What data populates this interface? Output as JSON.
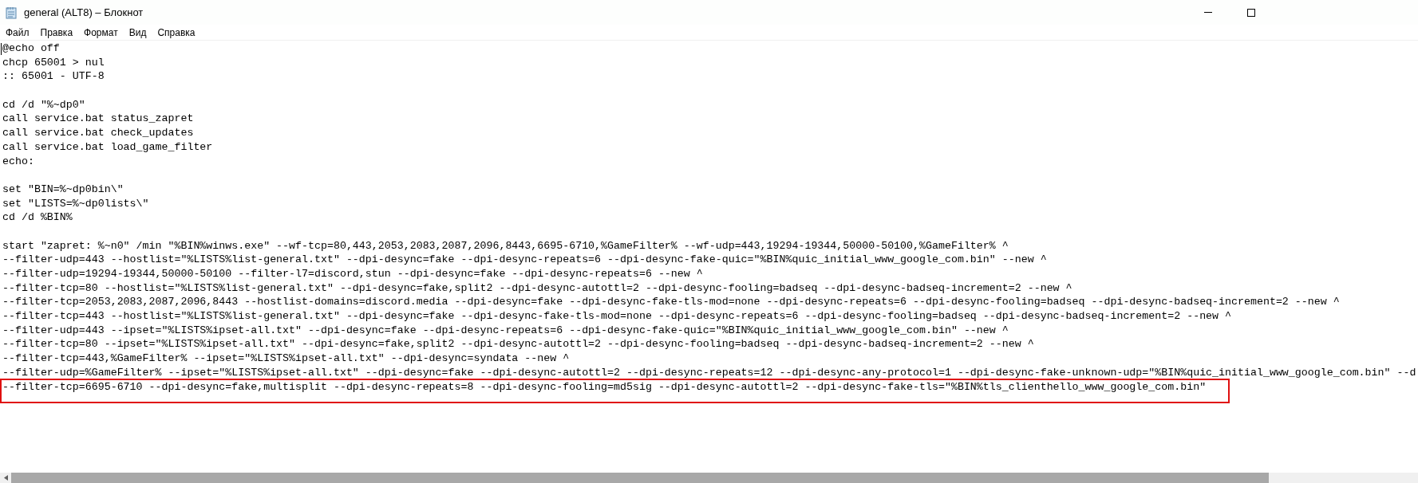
{
  "window": {
    "title": "general (ALT8) – Блокнот"
  },
  "menu": [
    "Файл",
    "Правка",
    "Формат",
    "Вид",
    "Справка"
  ],
  "lines": [
    {
      "text": "@echo off",
      "highlighted": false
    },
    {
      "text": "chcp 65001 > nul",
      "highlighted": false
    },
    {
      "text": ":: 65001 - UTF-8",
      "highlighted": false
    },
    {
      "highlighted": false
    },
    {
      "text": "cd /d \"%~dp0\"",
      "highlighted": false
    },
    {
      "text": "call service.bat status_zapret",
      "highlighted": false
    },
    {
      "text": "call service.bat check_updates",
      "highlighted": false
    },
    {
      "text": "call service.bat load_game_filter",
      "highlighted": false
    },
    {
      "text": "echo:",
      "highlighted": false
    },
    {
      "highlighted": false
    },
    {
      "text": "set \"BIN=%~dp0bin\\\"",
      "highlighted": false
    },
    {
      "text": "set \"LISTS=%~dp0lists\\\"",
      "highlighted": false
    },
    {
      "text": "cd /d %BIN%",
      "highlighted": false
    },
    {
      "highlighted": false
    },
    {
      "text": "start \"zapret: %~n0\" /min \"%BIN%winws.exe\" --wf-tcp=80,443,2053,2083,2087,2096,8443,6695-6710,%GameFilter% --wf-udp=443,19294-19344,50000-50100,%GameFilter% ^",
      "highlighted": false
    },
    {
      "text": "--filter-udp=443 --hostlist=\"%LISTS%list-general.txt\" --dpi-desync=fake --dpi-desync-repeats=6 --dpi-desync-fake-quic=\"%BIN%quic_initial_www_google_com.bin\" --new ^",
      "highlighted": false
    },
    {
      "text": "--filter-udp=19294-19344,50000-50100 --filter-l7=discord,stun --dpi-desync=fake --dpi-desync-repeats=6 --new ^",
      "highlighted": false
    },
    {
      "text": "--filter-tcp=80 --hostlist=\"%LISTS%list-general.txt\" --dpi-desync=fake,split2 --dpi-desync-autottl=2 --dpi-desync-fooling=badseq --dpi-desync-badseq-increment=2 --new ^",
      "highlighted": false
    },
    {
      "text": "--filter-tcp=2053,2083,2087,2096,8443 --hostlist-domains=discord.media --dpi-desync=fake --dpi-desync-fake-tls-mod=none --dpi-desync-repeats=6 --dpi-desync-fooling=badseq --dpi-desync-badseq-increment=2 --new ^",
      "highlighted": false
    },
    {
      "text": "--filter-tcp=443 --hostlist=\"%LISTS%list-general.txt\" --dpi-desync=fake --dpi-desync-fake-tls-mod=none --dpi-desync-repeats=6 --dpi-desync-fooling=badseq --dpi-desync-badseq-increment=2 --new ^",
      "highlighted": false
    },
    {
      "text": "--filter-udp=443 --ipset=\"%LISTS%ipset-all.txt\" --dpi-desync=fake --dpi-desync-repeats=6 --dpi-desync-fake-quic=\"%BIN%quic_initial_www_google_com.bin\" --new ^",
      "highlighted": false
    },
    {
      "text": "--filter-tcp=80 --ipset=\"%LISTS%ipset-all.txt\" --dpi-desync=fake,split2 --dpi-desync-autottl=2 --dpi-desync-fooling=badseq --dpi-desync-badseq-increment=2 --new ^",
      "highlighted": false
    },
    {
      "text": "--filter-tcp=443,%GameFilter% --ipset=\"%LISTS%ipset-all.txt\" --dpi-desync=syndata --new ^",
      "highlighted": false
    },
    {
      "text": "--filter-udp=%GameFilter% --ipset=\"%LISTS%ipset-all.txt\" --dpi-desync=fake --dpi-desync-autottl=2 --dpi-desync-repeats=12 --dpi-desync-any-protocol=1 --dpi-desync-fake-unknown-udp=\"%BIN%quic_initial_www_google_com.bin\" --d",
      "highlighted": false
    },
    {
      "text": "--filter-tcp=6695-6710 --dpi-desync=fake,multisplit --dpi-desync-repeats=8 --dpi-desync-fooling=md5sig --dpi-desync-autottl=2 --dpi-desync-fake-tls=\"%BIN%tls_clienthello_www_google_com.bin\"",
      "highlighted": true
    }
  ]
}
